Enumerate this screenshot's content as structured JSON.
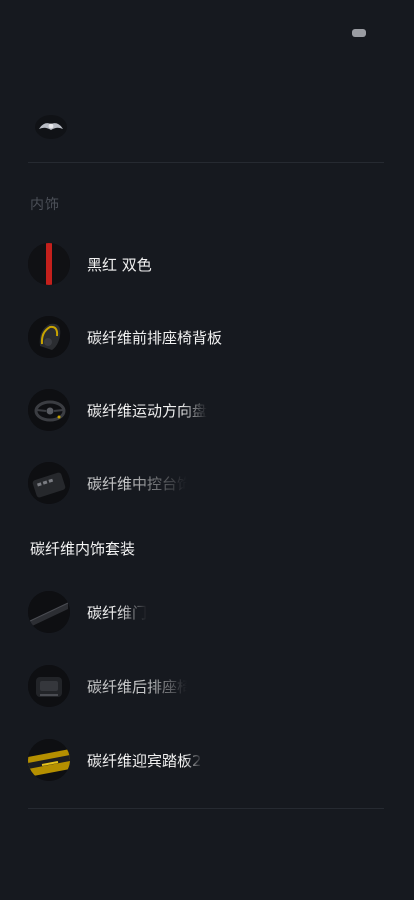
{
  "header": {
    "status_icon": "pill-indicator-icon"
  },
  "brand": {
    "logo_icon": "brand-emblem-icon"
  },
  "interior_section": {
    "label": "内饰",
    "items": [
      {
        "label": "黑红 双色",
        "icon": "red-black-swatch-icon"
      },
      {
        "label": "碳纤维前排座椅背板",
        "icon": "seat-back-thumbnail"
      },
      {
        "label": "碳纤维运动方向盘",
        "icon": "steering-wheel-thumbnail"
      },
      {
        "label": "碳纤维中控台饰",
        "icon": "center-console-thumbnail"
      }
    ]
  },
  "package_section": {
    "title": "碳纤维内饰套装",
    "items": [
      {
        "label": "碳纤维门",
        "icon": "door-trim-thumbnail"
      },
      {
        "label": "碳纤维后排座椅",
        "icon": "rear-seat-thumbnail"
      },
      {
        "label": "碳纤维迎宾踏板2",
        "icon": "door-sill-thumbnail"
      }
    ]
  }
}
